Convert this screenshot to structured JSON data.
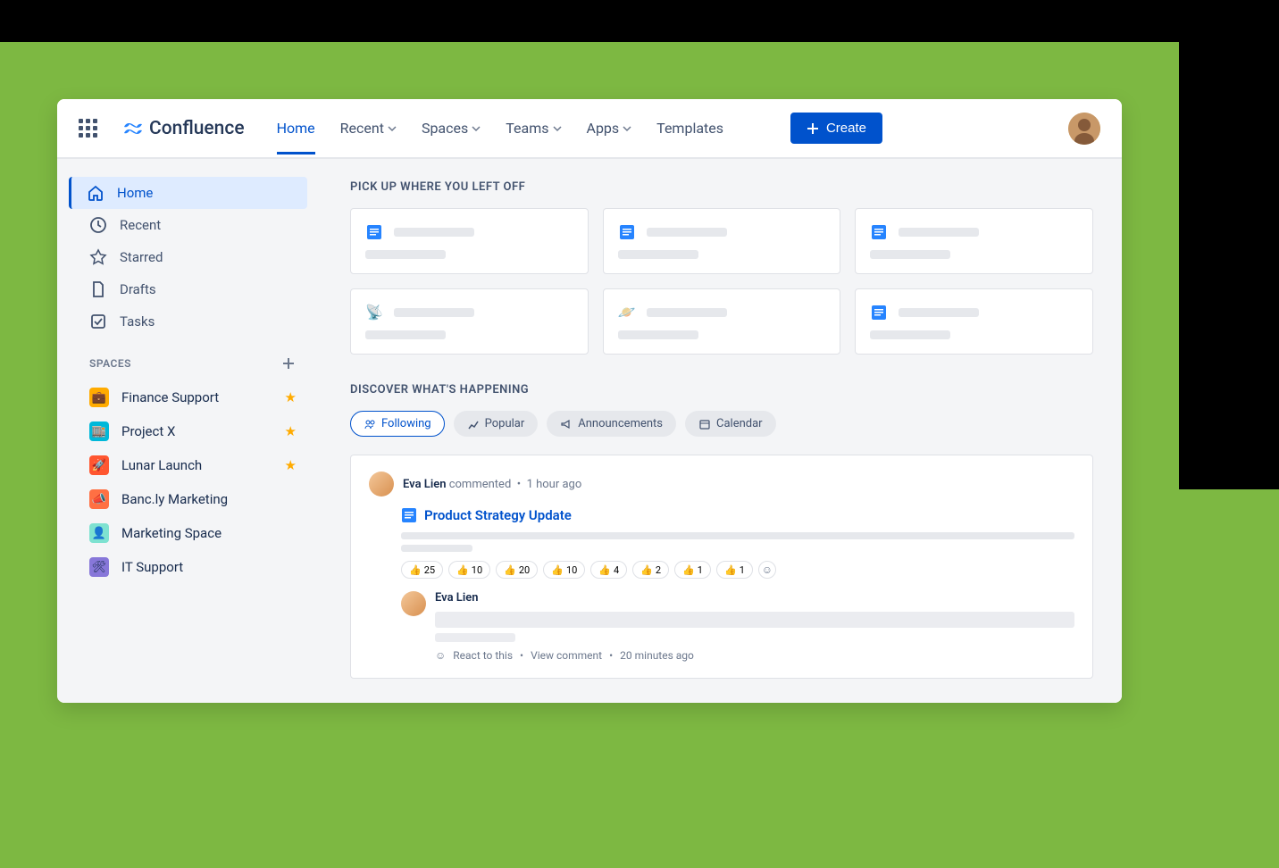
{
  "brand": "Confluence",
  "nav": {
    "home": "Home",
    "recent": "Recent",
    "spaces": "Spaces",
    "teams": "Teams",
    "apps": "Apps",
    "templates": "Templates"
  },
  "create_label": "Create",
  "sidebar": {
    "home": "Home",
    "recent": "Recent",
    "starred": "Starred",
    "drafts": "Drafts",
    "tasks": "Tasks",
    "spaces_header": "SPACES",
    "spaces": [
      {
        "name": "Finance Support",
        "starred": true,
        "color": "#ffab00"
      },
      {
        "name": "Project X",
        "starred": true,
        "color": "#00b8d9"
      },
      {
        "name": "Lunar Launch",
        "starred": true,
        "color": "#ff5630"
      },
      {
        "name": "Banc.ly Marketing",
        "starred": false,
        "color": "#ff7043"
      },
      {
        "name": "Marketing Space",
        "starred": false,
        "color": "#7ee2d1"
      },
      {
        "name": "IT Support",
        "starred": false,
        "color": "#8777d9"
      }
    ]
  },
  "sections": {
    "pickup": "PICK UP WHERE YOU LEFT OFF",
    "discover": "DISCOVER WHAT'S HAPPENING"
  },
  "filters": {
    "following": "Following",
    "popular": "Popular",
    "announcements": "Announcements",
    "calendar": "Calendar"
  },
  "activity": {
    "author": "Eva Lien",
    "action": "commented",
    "time": "1 hour ago",
    "page_title": "Product Strategy Update",
    "reactions": [
      {
        "emoji": "👍",
        "count": "25"
      },
      {
        "emoji": "👍",
        "count": "10"
      },
      {
        "emoji": "👍",
        "count": "20"
      },
      {
        "emoji": "👍",
        "count": "10"
      },
      {
        "emoji": "👍",
        "count": "4"
      },
      {
        "emoji": "👍",
        "count": "2"
      },
      {
        "emoji": "👍",
        "count": "1"
      },
      {
        "emoji": "👍",
        "count": "1"
      }
    ],
    "reply_author": "Eva Lien",
    "react_label": "React to this",
    "view_label": "View comment",
    "reply_time": "20 minutes ago"
  }
}
